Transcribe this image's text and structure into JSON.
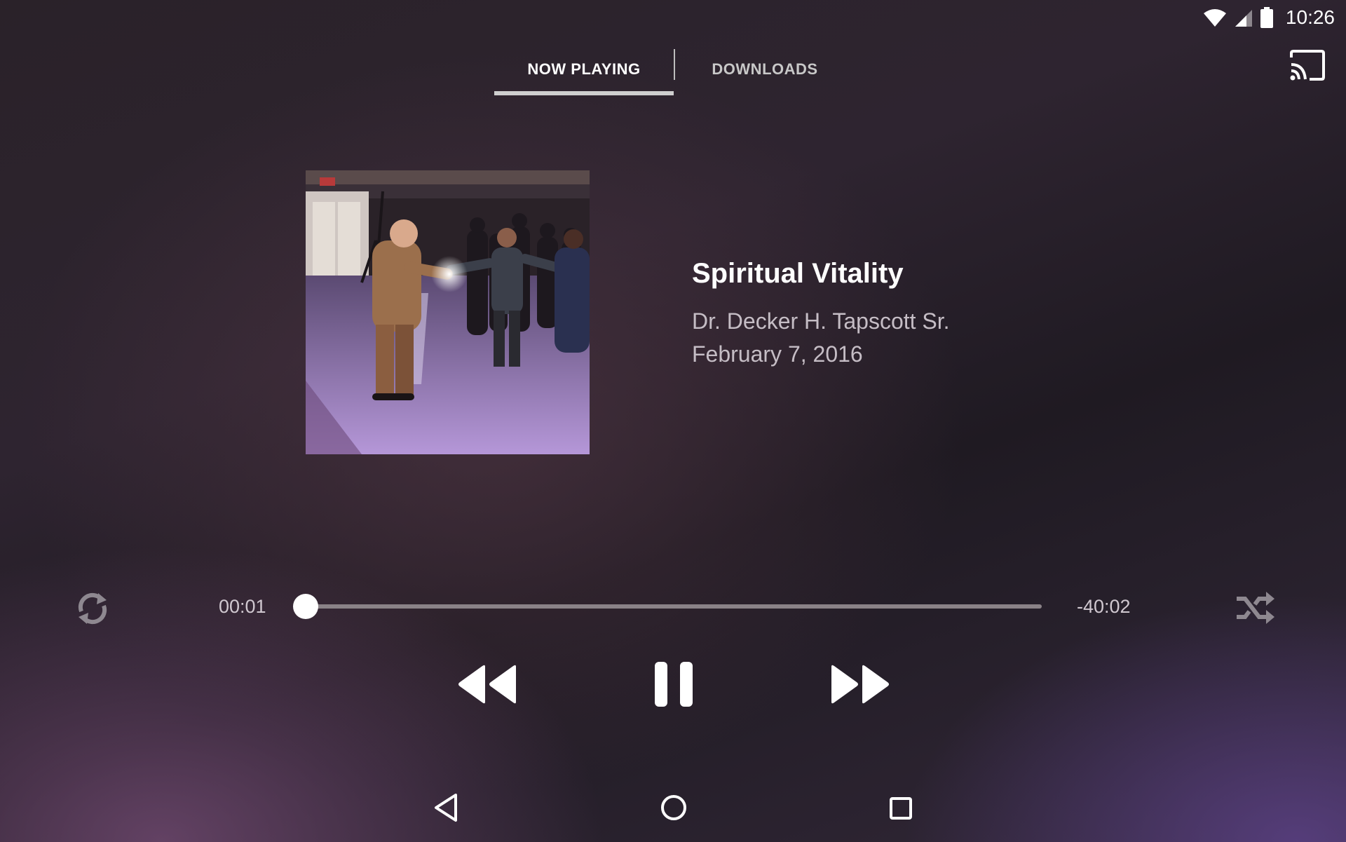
{
  "status_bar": {
    "time": "10:26",
    "icons": [
      "wifi-icon",
      "cell-signal-icon",
      "battery-icon"
    ]
  },
  "tabs": [
    {
      "label": "NOW PLAYING",
      "active": true
    },
    {
      "label": "DOWNLOADS",
      "active": false
    }
  ],
  "toolbar": {
    "cast_icon": "cast-icon"
  },
  "track": {
    "title": "Spiritual Vitality",
    "speaker": "Dr. Decker H. Tapscott Sr.",
    "date": "February 7, 2016",
    "artwork": "preacher-on-stage-photo"
  },
  "player": {
    "elapsed": "00:01",
    "remaining": "-40:02",
    "progress_fraction": 0.0,
    "state": "playing",
    "repeat_icon": "repeat-icon",
    "shuffle_icon": "shuffle-icon",
    "rewind_icon": "rewind-icon",
    "pause_icon": "pause-icon",
    "forward_icon": "fast-forward-icon"
  },
  "nav_bar": {
    "icons": [
      "back-icon",
      "home-icon",
      "recents-icon"
    ]
  },
  "colors": {
    "accent": "#ffffff",
    "muted_text": "#c5bdc5",
    "seek_track": "#8a8287"
  }
}
